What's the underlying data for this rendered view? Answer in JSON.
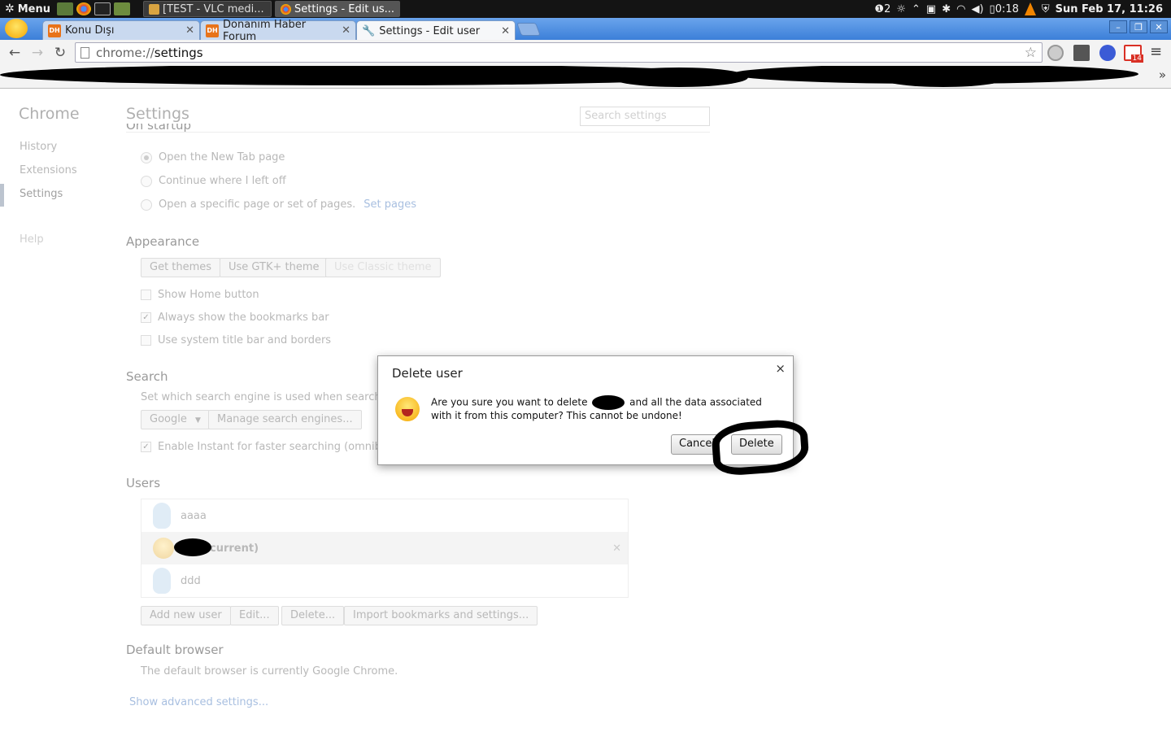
{
  "panel": {
    "menu_label": "Menu",
    "tasks": [
      {
        "label": "[TEST - VLC medi...",
        "active": false
      },
      {
        "label": "Settings - Edit us...",
        "active": true
      }
    ],
    "tray": {
      "notifications": "2",
      "battery": "0:18",
      "clock": "Sun Feb 17, 11:26"
    }
  },
  "browser": {
    "tabs": [
      {
        "label": "Konu Dışı",
        "favicon": "DH"
      },
      {
        "label": "Donanım Haber Forum",
        "favicon": "DH"
      },
      {
        "label": "Settings - Edit user",
        "favicon": "wrench-icon"
      }
    ],
    "omnibox": {
      "scheme": "chrome://",
      "path": "settings"
    },
    "extension_badge": "14"
  },
  "settings": {
    "brand": "Chrome",
    "nav": {
      "history": "History",
      "extensions": "Extensions",
      "settings": "Settings",
      "help": "Help"
    },
    "title": "Settings",
    "search_placeholder": "Search settings",
    "on_startup": {
      "heading": "On startup",
      "option_new_tab": "Open the New Tab page",
      "option_continue": "Continue where I left off",
      "option_specific": "Open a specific page or set of pages.",
      "set_pages": "Set pages"
    },
    "appearance": {
      "heading": "Appearance",
      "get_themes": "Get themes",
      "use_gtk": "Use GTK+ theme",
      "use_classic": "Use Classic theme",
      "show_home": "Show Home button",
      "always_bookmarks": "Always show the bookmarks bar",
      "system_title_bar": "Use system title bar and borders"
    },
    "search": {
      "heading": "Search",
      "description": "Set which search engine is used when searching",
      "engine": "Google",
      "manage": "Manage search engines...",
      "instant": "Enable Instant for faster searching (omnibox"
    },
    "users": {
      "heading": "Users",
      "list": [
        {
          "name": "aaaa",
          "current": false
        },
        {
          "name": "current)",
          "current": true
        },
        {
          "name": "ddd",
          "current": false
        }
      ],
      "add": "Add new user",
      "edit": "Edit...",
      "delete": "Delete...",
      "import": "Import bookmarks and settings..."
    },
    "default_browser": {
      "heading": "Default browser",
      "text": "The default browser is currently Google Chrome."
    },
    "advanced": "Show advanced settings..."
  },
  "dialog": {
    "title": "Delete user",
    "close": "×",
    "message_before": "Are you sure you want to delete",
    "message_after": "and all the data associated with it from this computer? This cannot be undone!",
    "cancel": "Cancel",
    "delete": "Delete"
  }
}
